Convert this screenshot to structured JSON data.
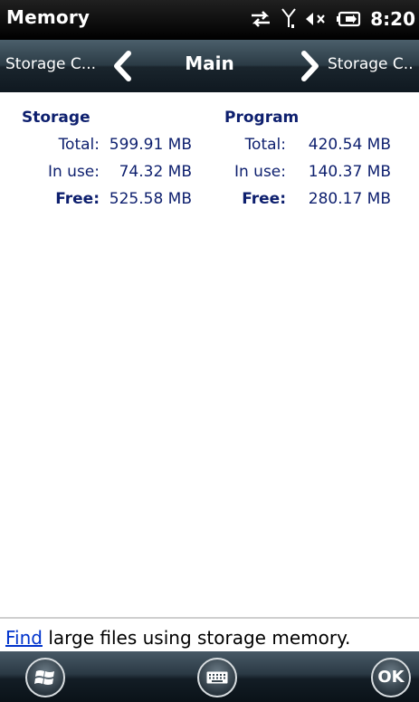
{
  "titlebar": {
    "title": "Memory",
    "clock": "8:20",
    "icons": [
      "sync-arrows-icon",
      "signal-antenna-icon",
      "speaker-muted-icon",
      "battery-charging-icon"
    ]
  },
  "pager": {
    "prev_label": "Storage C...",
    "current": "Main",
    "next_label": "Storage C.."
  },
  "storage": {
    "heading": "Storage",
    "total_label": "Total:",
    "total_value": "599.91 MB",
    "inuse_label": "In use:",
    "inuse_value": "74.32 MB",
    "free_label": "Free:",
    "free_value": "525.58 MB"
  },
  "program": {
    "heading": "Program",
    "total_label": "Total:",
    "total_value": "420.54 MB",
    "inuse_label": "In use:",
    "inuse_value": "140.37 MB",
    "free_label": "Free:",
    "free_value": "280.17 MB"
  },
  "footer": {
    "link": "Find",
    "text": " large files using storage memory."
  },
  "softkeys": {
    "ok_label": "OK",
    "icons": [
      "windows-start-icon",
      "keyboard-icon"
    ]
  },
  "colors": {
    "text": "#0d1f6e",
    "link": "#0033cc",
    "titlebar": "#000000"
  }
}
